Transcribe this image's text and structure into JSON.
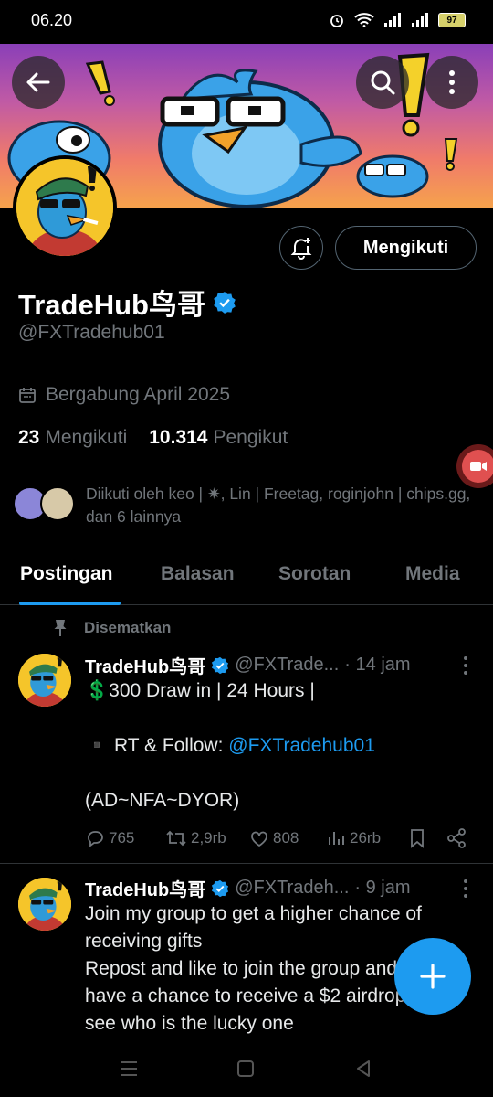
{
  "status_bar": {
    "time": "06.20",
    "battery": "97"
  },
  "profile": {
    "display_name": "TradeHub鸟哥",
    "handle": "@FXTradehub01",
    "joined": "Bergabung April 2025",
    "following_count": "23",
    "following_label": "Mengikuti",
    "followers_count": "10.314",
    "followers_label": "Pengikut",
    "followed_by": "Diikuti oleh keo | ✷, Lin | Freetag, roginjohn | chips.gg, dan 6 lainnya",
    "follow_button": "Mengikuti"
  },
  "tabs": [
    {
      "label": "Postingan",
      "active": true
    },
    {
      "label": "Balasan",
      "active": false
    },
    {
      "label": "Sorotan",
      "active": false
    },
    {
      "label": "Media",
      "active": false
    }
  ],
  "pinned_label": "Disematkan",
  "tweets": [
    {
      "name": "TradeHub鸟哥",
      "handle": "@FXTrade...",
      "time": "· 14 jam",
      "line1": "💲300 Draw in | 24 Hours |",
      "line2_prefix": "▪️ RT & Follow: ",
      "line2_link": "@FXTradehub01",
      "line3": "(AD~NFA~DYOR)",
      "replies": "765",
      "reposts": "2,9rb",
      "likes": "808",
      "views": "26rb"
    },
    {
      "name": "TradeHub鸟哥",
      "handle": "@FXTradeh...",
      "time": "· 9 jam",
      "text": "Join my group to get a higher chance of receiving gifts\nRepost and like to join the group and you will have a chance to receive a $2 airdrop. Let's see who is the lucky one"
    }
  ],
  "colors": {
    "accent": "#1d9bf0",
    "background": "#000000",
    "muted": "#71767b",
    "avatar_bg": "#f5c52a"
  },
  "icons": [
    "back-arrow-icon",
    "search-icon",
    "more-vertical-icon",
    "notification-bell-icon",
    "verified-badge-icon",
    "calendar-icon",
    "pin-icon",
    "reply-icon",
    "repost-icon",
    "like-icon",
    "views-icon",
    "bookmark-icon",
    "share-icon",
    "plus-icon",
    "screen-record-icon"
  ]
}
